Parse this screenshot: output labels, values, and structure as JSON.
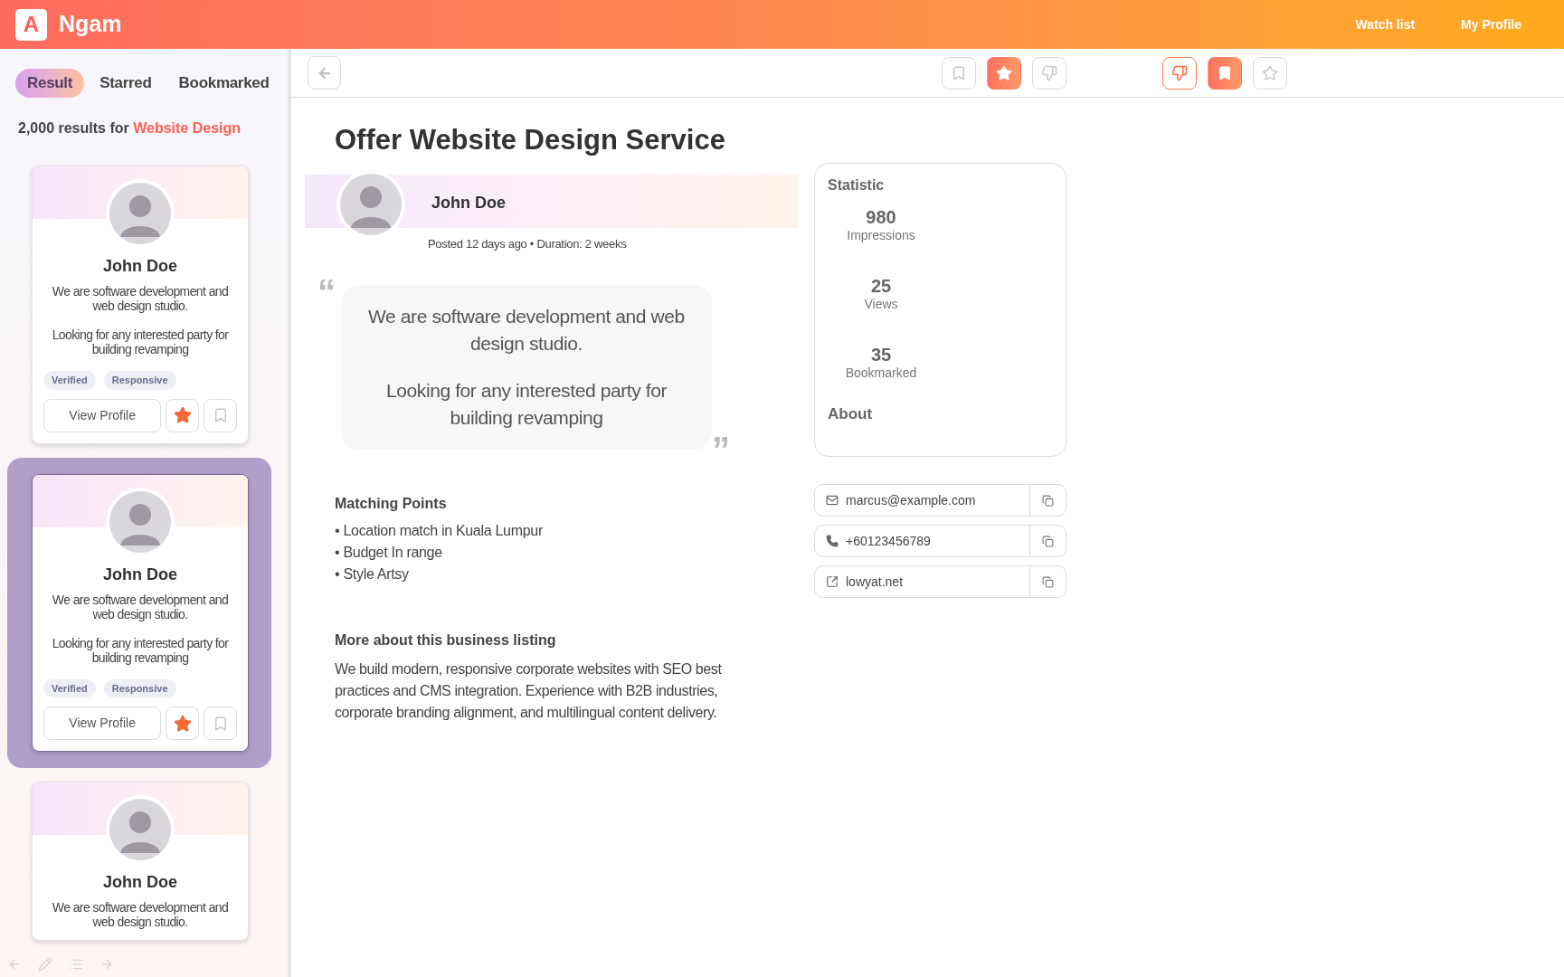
{
  "app": {
    "logo_letter": "A",
    "name": "Ngam"
  },
  "nav": [
    "Watch list",
    "My Profile"
  ],
  "tabs": [
    {
      "label": "Result",
      "selected": true
    },
    {
      "label": "Starred",
      "selected": false
    },
    {
      "label": "Bookmarked",
      "selected": false
    }
  ],
  "results_summary": {
    "count_text": "2,000 results for",
    "query": "Website Design"
  },
  "cards": [
    {
      "name": "John Doe",
      "description": "We are software development and web design studio.",
      "looking": "Looking for any interested party for building revamping",
      "tags": [
        "Verified",
        "Responsive"
      ],
      "button": "View Profile",
      "starred": true,
      "bookmarked": false,
      "selected": false
    },
    {
      "name": "John Doe",
      "description": "We are software development and web design studio.",
      "looking": "Looking for any interested party for building revamping",
      "tags": [
        "Verified",
        "Responsive"
      ],
      "button": "View Profile",
      "starred": true,
      "bookmarked": false,
      "selected": true
    },
    {
      "name": "John Doe",
      "description": "We are software development and web design studio.",
      "selected": false
    }
  ],
  "toolbar": {
    "left": [
      {
        "kind": "bookmark",
        "on": false
      },
      {
        "kind": "star",
        "on": true
      },
      {
        "kind": "dislike",
        "on": false
      }
    ],
    "right": [
      {
        "kind": "dislike",
        "on": true
      },
      {
        "kind": "bookmark",
        "on": true
      },
      {
        "kind": "star",
        "on": false
      }
    ]
  },
  "listing": {
    "title": "Offer Website Design Service",
    "poster": "John Doe",
    "meta": "Posted 12 days ago • Duration: 2 weeks",
    "quote_marks": [
      "“",
      "”"
    ],
    "quote": [
      "We are software development and web design studio.",
      "Looking for any interested party for building revamping"
    ],
    "matching_title": "Matching Points",
    "matching_points": [
      "• Location match in Kuala Lumpur",
      "• Budget In range",
      "• Style Artsy"
    ],
    "more_title": "More about this business listing",
    "more_text": "We build modern, responsive corporate websites with SEO best practices and CMS integration. Experience with B2B industries, corporate branding alignment, and multilingual content delivery."
  },
  "statistic": {
    "title": "Statistic",
    "items": [
      {
        "value": "980",
        "label": "Impressions"
      },
      {
        "value": "25",
        "label": "Views"
      },
      {
        "value": "35",
        "label": "Bookmarked"
      }
    ],
    "about": "About"
  },
  "contacts": [
    {
      "kind": "email",
      "text": "marcus@example.com"
    },
    {
      "kind": "phone",
      "text": "+60123456789"
    },
    {
      "kind": "link",
      "text": "lowyat.net"
    }
  ]
}
